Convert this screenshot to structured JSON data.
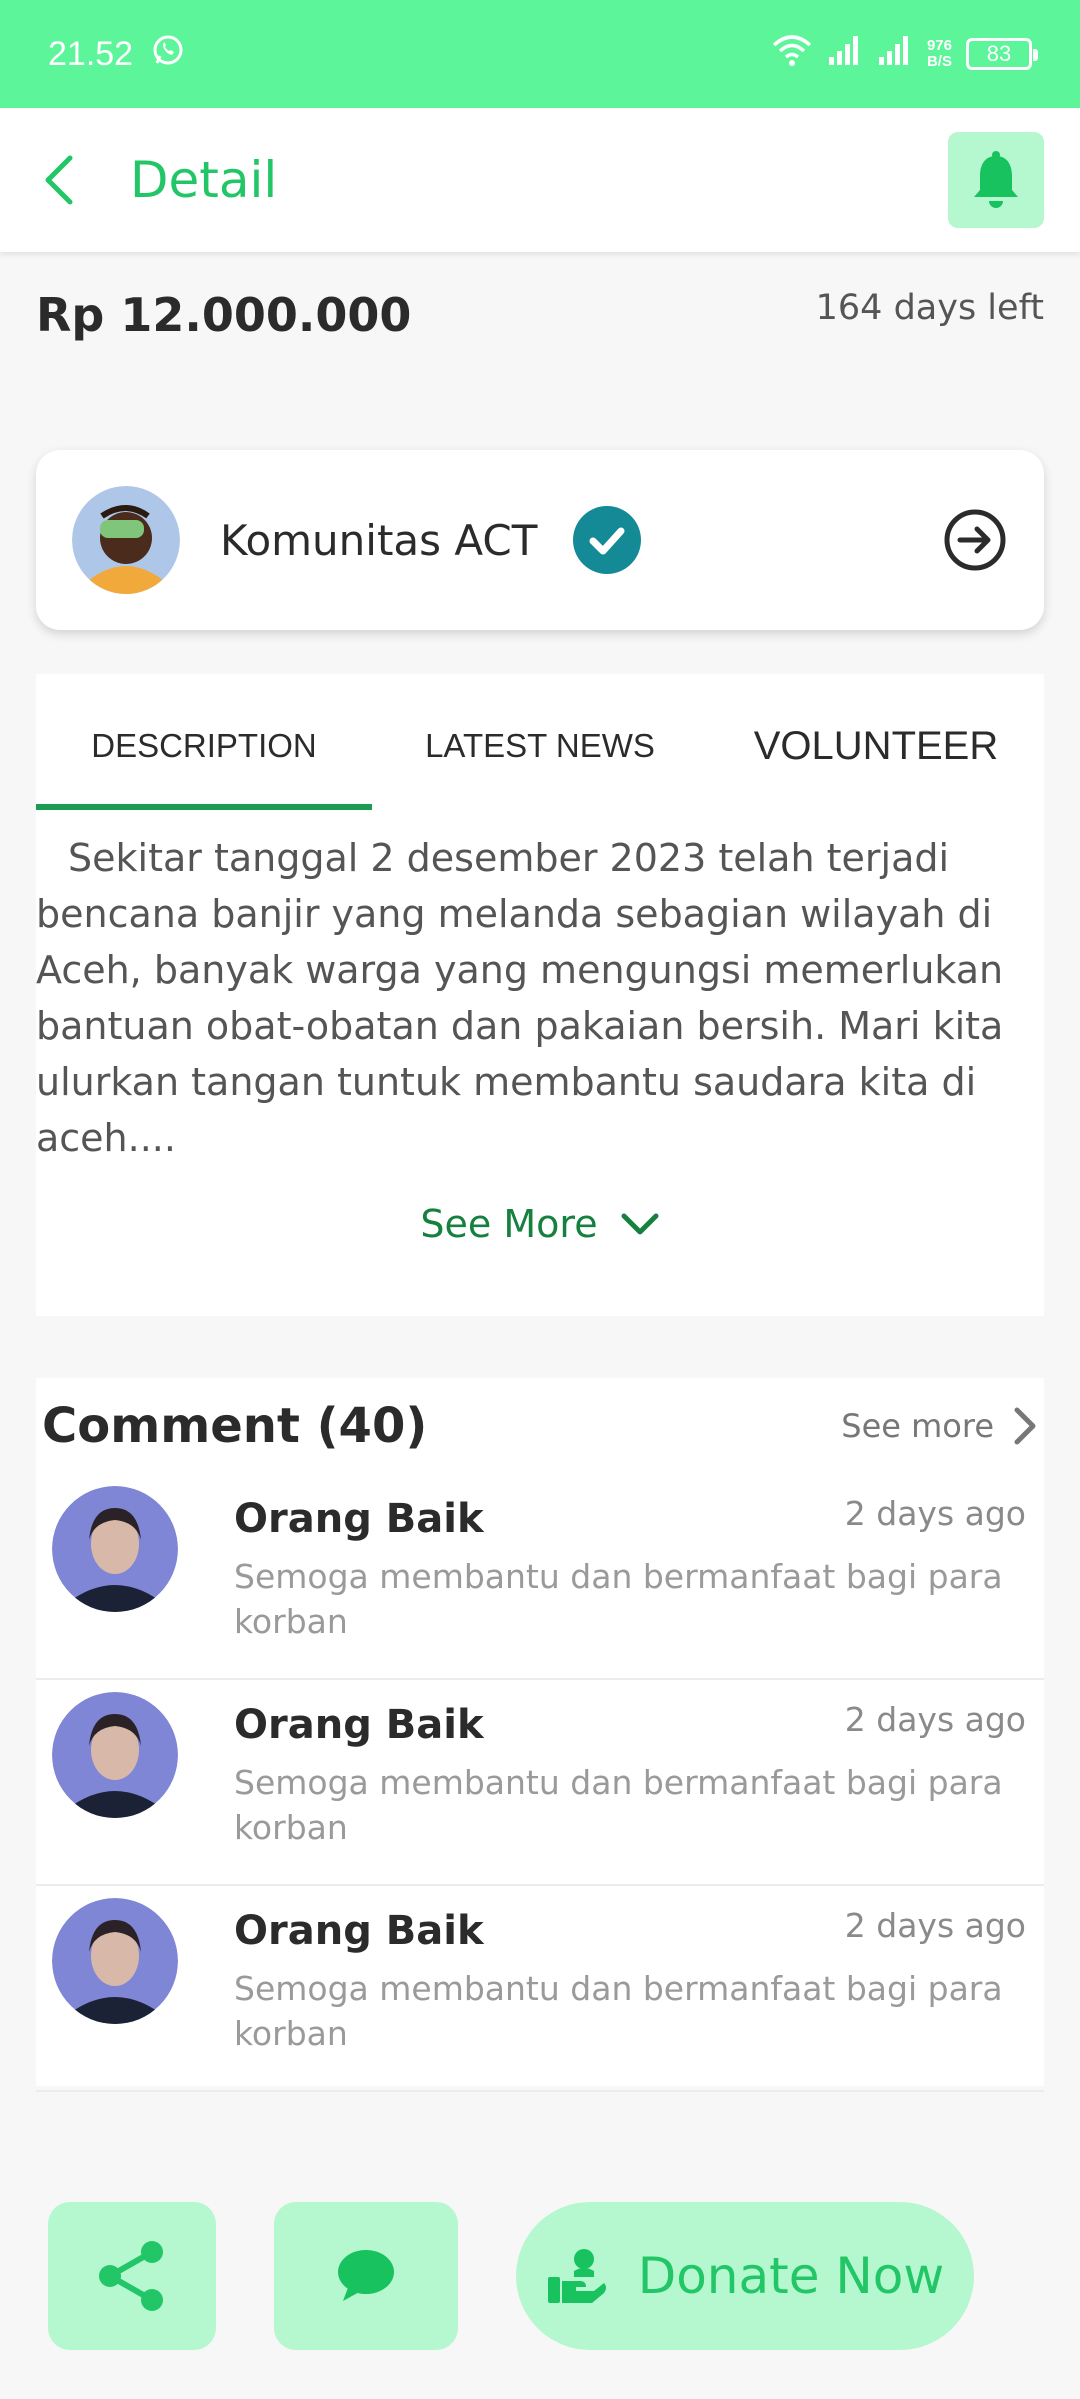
{
  "status_bar": {
    "time": "21.52",
    "net_speed_value": "976",
    "net_speed_unit": "B/S",
    "battery": "83"
  },
  "header": {
    "title": "Detail"
  },
  "campaign": {
    "amount": "Rp 12.000.000",
    "days_left": "164 days left"
  },
  "organizer": {
    "name": "Komunitas ACT",
    "verified": true
  },
  "tabs": [
    {
      "label": "DESCRIPTION",
      "active": true
    },
    {
      "label": "LATEST NEWS",
      "active": false
    },
    {
      "label": "VOLUNTEER",
      "active": false
    }
  ],
  "description": {
    "text": "Sekitar tanggal 2 desember 2023 telah terjadi bencana banjir yang melanda sebagian wilayah di Aceh, banyak warga yang mengungsi memerlukan bantuan obat-obatan dan pakaian bersih. Mari kita ulurkan tangan tuntuk membantu saudara kita di aceh....",
    "see_more": "See More"
  },
  "comments": {
    "title": "Comment (40)",
    "see_more": "See more",
    "items": [
      {
        "name": "Orang Baik",
        "time": "2 days ago",
        "text": "Semoga membantu dan bermanfaat bagi para korban"
      },
      {
        "name": "Orang Baik",
        "time": "2 days ago",
        "text": "Semoga membantu dan bermanfaat bagi para korban"
      },
      {
        "name": "Orang Baik",
        "time": "2 days ago",
        "text": "Semoga membantu dan bermanfaat bagi para korban"
      }
    ]
  },
  "bottom_bar": {
    "donate_label": "Donate Now"
  },
  "colors": {
    "status_bar": "#5cf59a",
    "accent_green": "#22c667",
    "button_bg": "#b5f8cf",
    "tab_indicator": "#1b9c52",
    "verified_badge": "#138a96"
  },
  "icons": {
    "back": "chevron-left-icon",
    "notification": "bell-icon",
    "verified": "check-circle-icon",
    "open_profile": "arrow-right-circle-icon",
    "expand": "chevron-down-icon",
    "see_more": "chevron-right-icon",
    "share": "share-icon",
    "comment": "chat-bubble-icon",
    "donate": "donate-hand-icon"
  }
}
